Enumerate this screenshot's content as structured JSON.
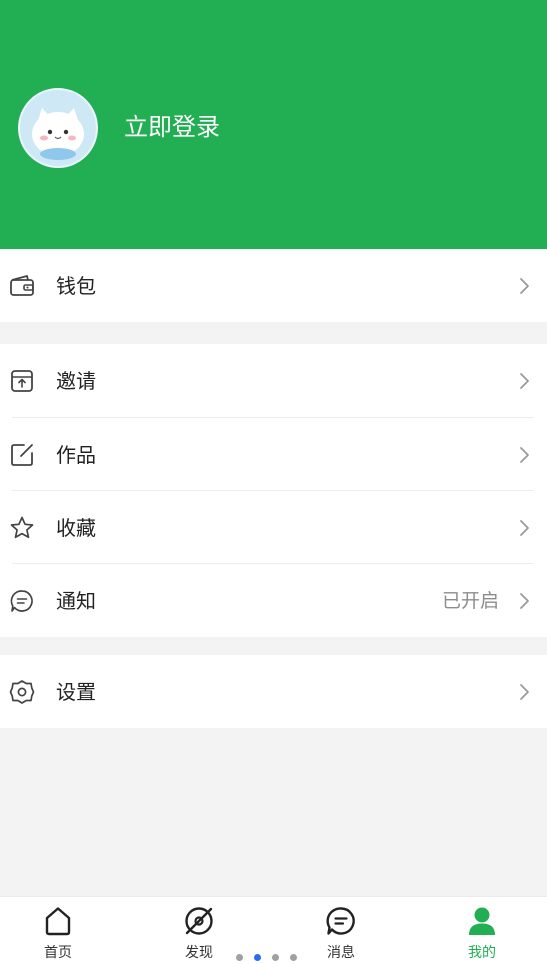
{
  "header": {
    "login_text": "立即登录",
    "background_color": "#22ae52"
  },
  "menu": {
    "wallet": {
      "label": "钱包",
      "icon": "wallet-icon"
    },
    "invite": {
      "label": "邀请",
      "icon": "invite-box-icon"
    },
    "works": {
      "label": "作品",
      "icon": "edit-square-icon"
    },
    "favorites": {
      "label": "收藏",
      "icon": "star-icon"
    },
    "notifications": {
      "label": "通知",
      "value": "已开启",
      "icon": "chat-bubble-icon"
    },
    "settings": {
      "label": "设置",
      "icon": "gear-icon"
    }
  },
  "tabbar": {
    "items": [
      {
        "label": "首页",
        "icon": "home-icon",
        "active": false
      },
      {
        "label": "发现",
        "icon": "compass-icon",
        "active": false
      },
      {
        "label": "消息",
        "icon": "message-icon",
        "active": false
      },
      {
        "label": "我的",
        "icon": "user-icon",
        "active": true
      }
    ],
    "active_color": "#22ae52"
  },
  "page_indicator": {
    "count": 4,
    "current": 2
  }
}
